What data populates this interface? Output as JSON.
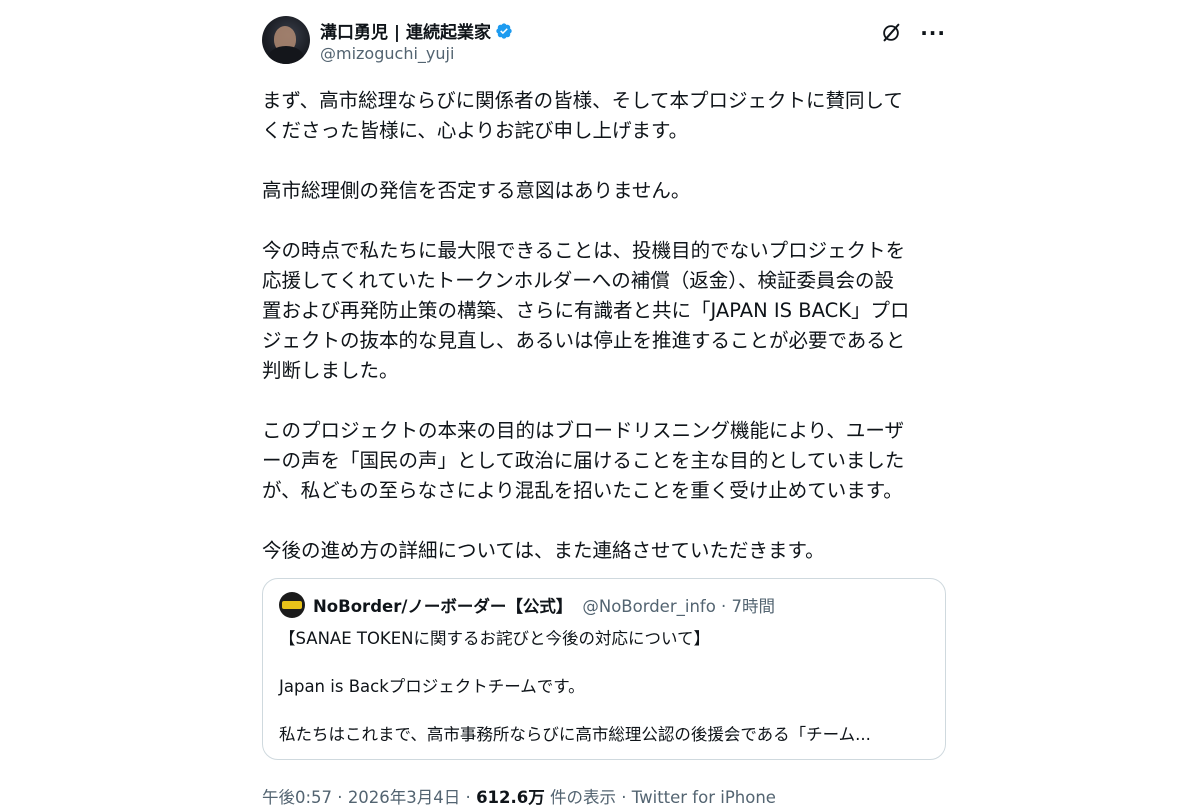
{
  "author": {
    "display_name": "溝口勇児 | 連続起業家",
    "handle": "@mizoguchi_yuji",
    "verified_icon": "verified-badge-icon",
    "verified_color": "#1d9bf0"
  },
  "actions": {
    "grok_icon": "grok-icon",
    "more_icon": "more-icon",
    "more_glyph": "···"
  },
  "body": {
    "p1_line1": "まず、高市総理ならびに関係者の皆様、そして本プロジェクトに賛同して",
    "p1_line2": "くださった皆様に、心よりお詫び申し上げます。",
    "p2": "高市総理側の発信を否定する意図はありません。",
    "p3_line1": "今の時点で私たちに最大限できることは、投機目的でないプロジェクトを",
    "p3_line2": "応援してくれていたトークンホルダーへの補償（返金）、検証委員会の設",
    "p3_line3": "置および再発防止策の構築、さらに有識者と共に「JAPAN IS BACK」プロ",
    "p3_line4": "ジェクトの抜本的な見直し、あるいは停止を推進することが必要であると",
    "p3_line5": "判断しました。",
    "p4_line1": "このプロジェクトの本来の目的はブロードリスニング機能により、ユーザ",
    "p4_line2": "ーの声を「国民の声」として政治に届けることを主な目的としていました",
    "p4_line3": "が、私どもの至らなさにより混乱を招いたことを重く受け止めています。",
    "p5": "今後の進め方の詳細については、また連絡させていただきます。"
  },
  "quote": {
    "display_name": "NoBorder/ノーボーダー【公式】",
    "meta": "@NoBorder_info · 7時間",
    "line1": "【SANAE TOKENに関するお詫びと今後の対応について】",
    "line2": "Japan is Backプロジェクトチームです。",
    "line3": "私たちはこれまで、高市事務所ならびに高市総理公認の後援会である「チーム..."
  },
  "footer": {
    "time": "午後0:57",
    "date": "2026年3月4日",
    "separator": " · ",
    "views_count": "612.6万",
    "views_label": "件の表示",
    "source": "Twitter for iPhone"
  }
}
